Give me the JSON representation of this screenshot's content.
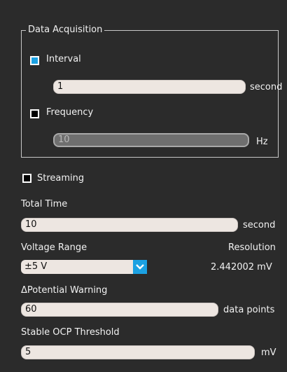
{
  "acquisition": {
    "title": "Data Acquisition",
    "interval": {
      "label": "Interval",
      "checked": true,
      "value": "1",
      "unit": "second"
    },
    "frequency": {
      "label": "Frequency",
      "checked": false,
      "value": "10",
      "unit": "Hz"
    }
  },
  "streaming": {
    "label": "Streaming",
    "checked": false
  },
  "total_time": {
    "label": "Total Time",
    "value": "10",
    "unit": "second"
  },
  "voltage_range": {
    "label": "Voltage Range",
    "selected": "±5 V"
  },
  "resolution": {
    "label": "Resolution",
    "value": "2.442002 mV"
  },
  "potential_warning": {
    "label": "ΔPotential Warning",
    "value": "60",
    "unit": "data points"
  },
  "ocp_threshold": {
    "label": "Stable OCP Threshold",
    "value": "5",
    "unit": "mV"
  },
  "colors": {
    "accent": "#1ba1e2",
    "background": "#2b2b2b",
    "field": "#ede6e1"
  },
  "icons": {
    "dropdown": "chevron-down-icon"
  }
}
